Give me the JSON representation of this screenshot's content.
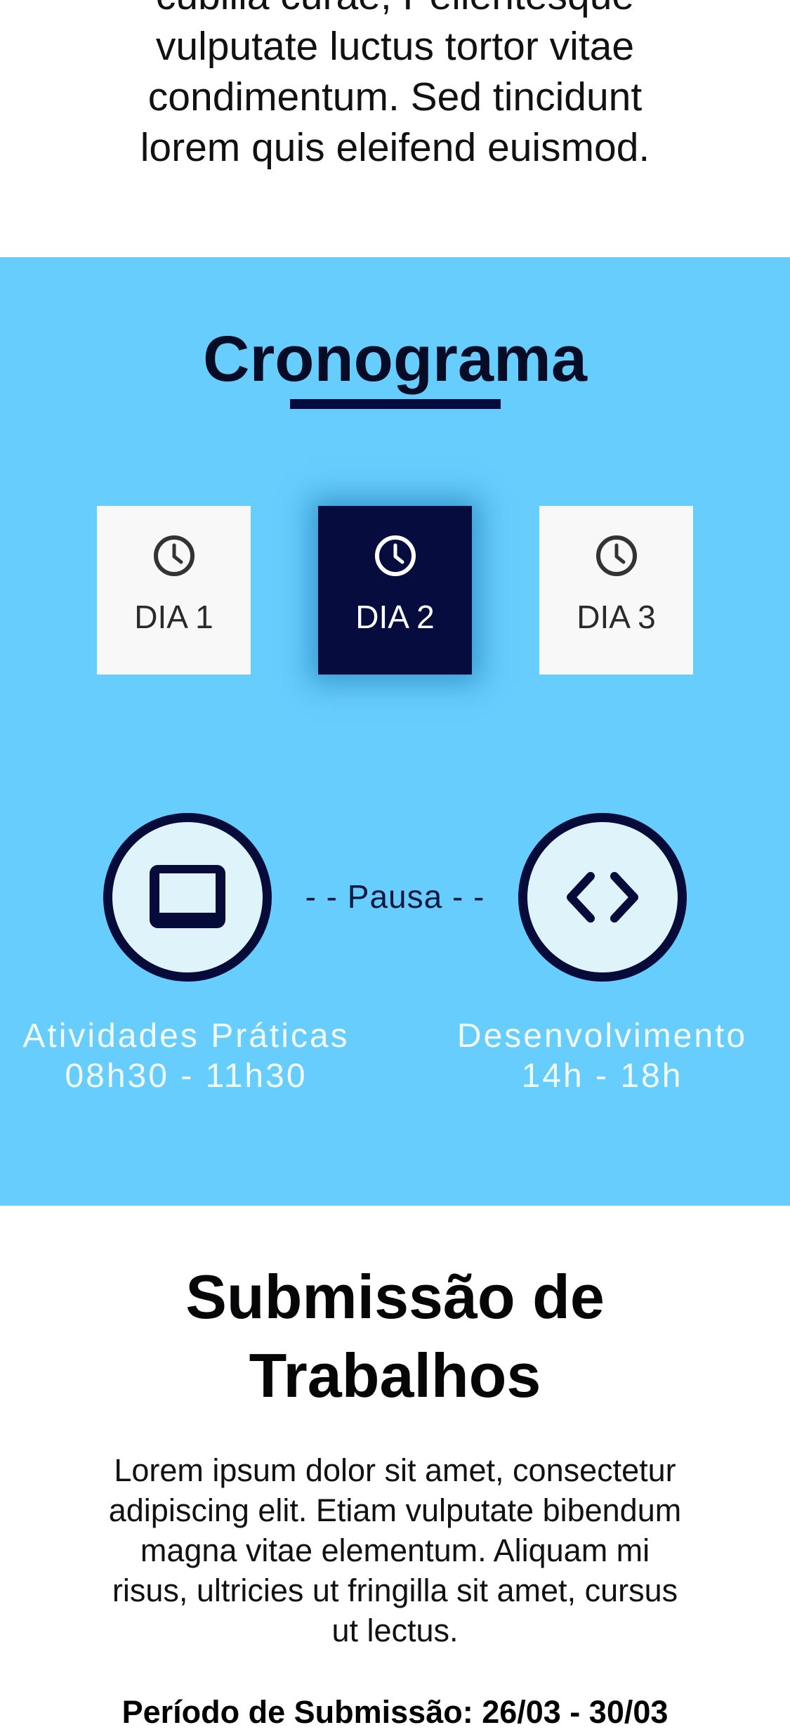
{
  "intro": {
    "text": "cubilia curae; Pellentesque vulputate luctus tortor vitae condimentum. Sed tincidunt lorem quis eleifend euismod."
  },
  "schedule": {
    "title": "Cronograma",
    "background_color": "#66cdfd",
    "accent_color": "#060c3d",
    "tabs": [
      {
        "label": "DIA 1",
        "icon": "clock-icon",
        "active": false
      },
      {
        "label": "DIA 2",
        "icon": "clock-icon",
        "active": true
      },
      {
        "label": "DIA 3",
        "icon": "clock-icon",
        "active": false
      }
    ],
    "pause_label": "- - Pausa - -",
    "activities": [
      {
        "icon": "laptop-icon",
        "name": "Atividades Práticas",
        "time": "08h30 - 11h30"
      },
      {
        "icon": "code-icon",
        "name": "Desenvolvimento",
        "time": "14h - 18h"
      }
    ]
  },
  "submission": {
    "title_line1": "Submissão de",
    "title_line2": "Trabalhos",
    "text": "Lorem ipsum dolor sit amet, consectetur adipiscing elit. Etiam vulputate bibendum magna vitae elementum. Aliquam mi risus, ultricies ut fringilla sit amet, cursus ut lectus.",
    "period": "Período de Submissão: 26/03 - 30/03"
  }
}
